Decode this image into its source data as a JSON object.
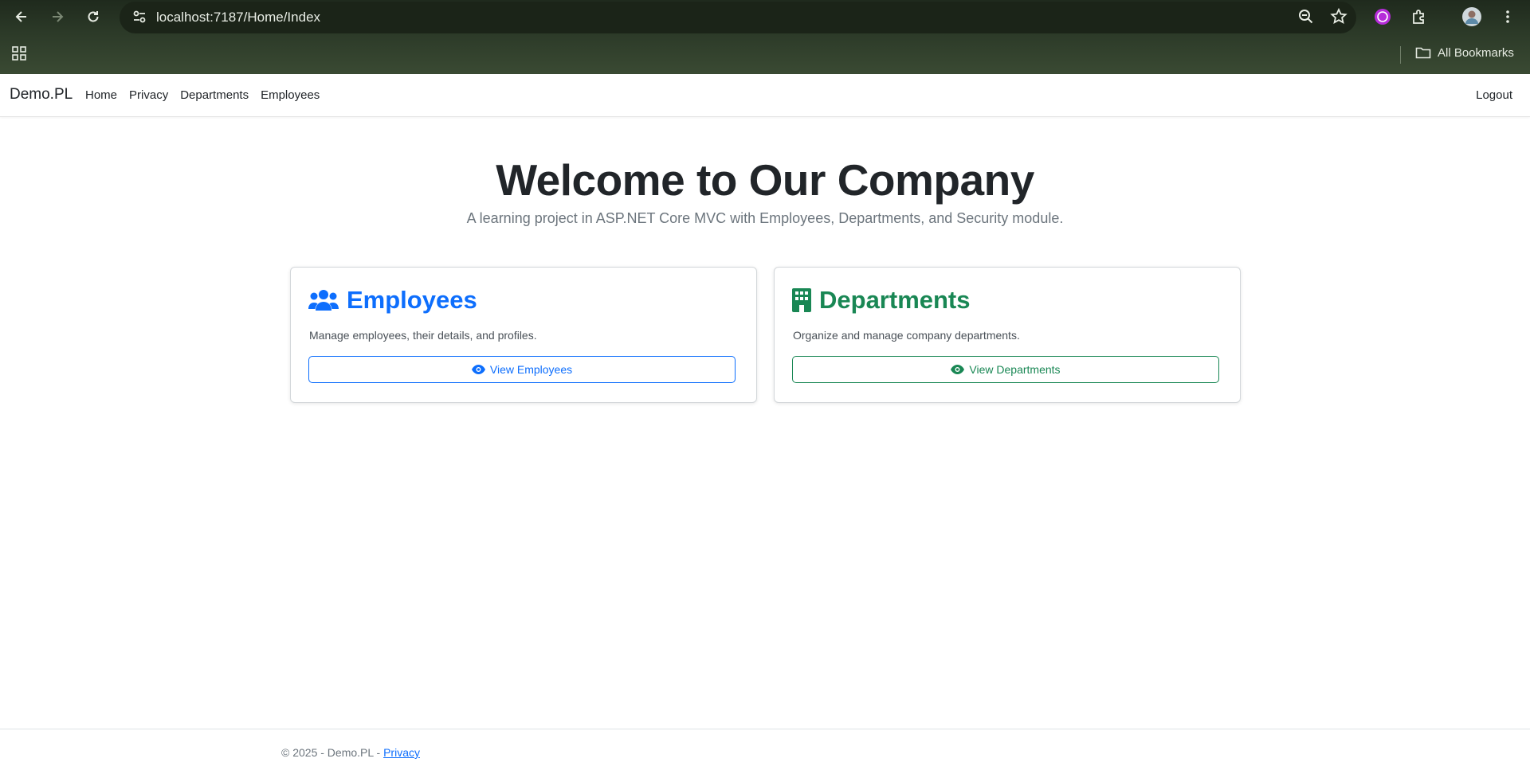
{
  "browser": {
    "url": "localhost:7187/Home/Index",
    "bookmarks_label": "All Bookmarks"
  },
  "navbar": {
    "brand": "Demo.PL",
    "links": [
      "Home",
      "Privacy",
      "Departments",
      "Employees"
    ],
    "logout": "Logout"
  },
  "hero": {
    "title": "Welcome to Our Company",
    "subtitle": "A learning project in ASP.NET Core MVC with Employees, Departments, and Security module."
  },
  "cards": [
    {
      "title": "Employees",
      "description": "Manage employees, their details, and profiles.",
      "button": "View Employees",
      "icon": "users-icon",
      "color": "#0d6efd"
    },
    {
      "title": "Departments",
      "description": "Organize and manage company departments.",
      "button": "View Departments",
      "icon": "building-icon",
      "color": "#198754"
    }
  ],
  "footer": {
    "copyright": "© 2025 - Demo.PL - ",
    "privacy_link": "Privacy"
  }
}
